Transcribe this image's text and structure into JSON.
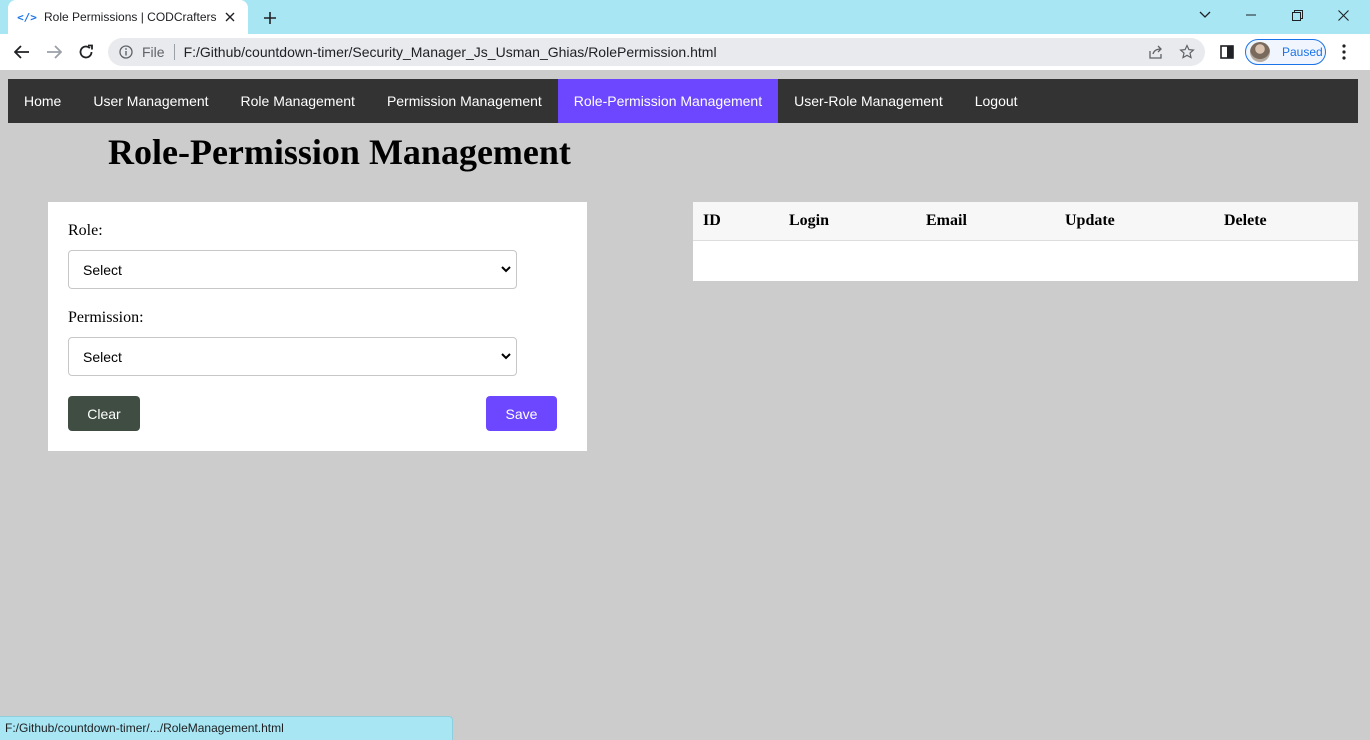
{
  "browser": {
    "tab_title": "Role Permissions | CODCrafters",
    "address_scheme": "File",
    "url": "F:/Github/countdown-timer/Security_Manager_Js_Usman_Ghias/RolePermission.html",
    "profile_status": "Paused",
    "status_url": "F:/Github/countdown-timer/.../RoleManagement.html",
    "accent_color": "#a8e6f3"
  },
  "navbar": {
    "items": [
      {
        "label": "Home",
        "active": false
      },
      {
        "label": "User Management",
        "active": false
      },
      {
        "label": "Role Management",
        "active": false
      },
      {
        "label": "Permission Management",
        "active": false
      },
      {
        "label": "Role-Permission Management",
        "active": true
      },
      {
        "label": "User-Role Management",
        "active": false
      },
      {
        "label": "Logout",
        "active": false
      }
    ],
    "background_color": "#333333",
    "active_color": "#6c47ff"
  },
  "page": {
    "title": "Role-Permission Management"
  },
  "form": {
    "role_label": "Role:",
    "role_value": "Select",
    "permission_label": "Permission:",
    "permission_value": "Select",
    "clear_label": "Clear",
    "save_label": "Save",
    "clear_color": "#3f4d43",
    "save_color": "#6c47ff"
  },
  "table": {
    "columns": [
      "ID",
      "Login",
      "Email",
      "Update",
      "Delete"
    ],
    "rows": []
  }
}
